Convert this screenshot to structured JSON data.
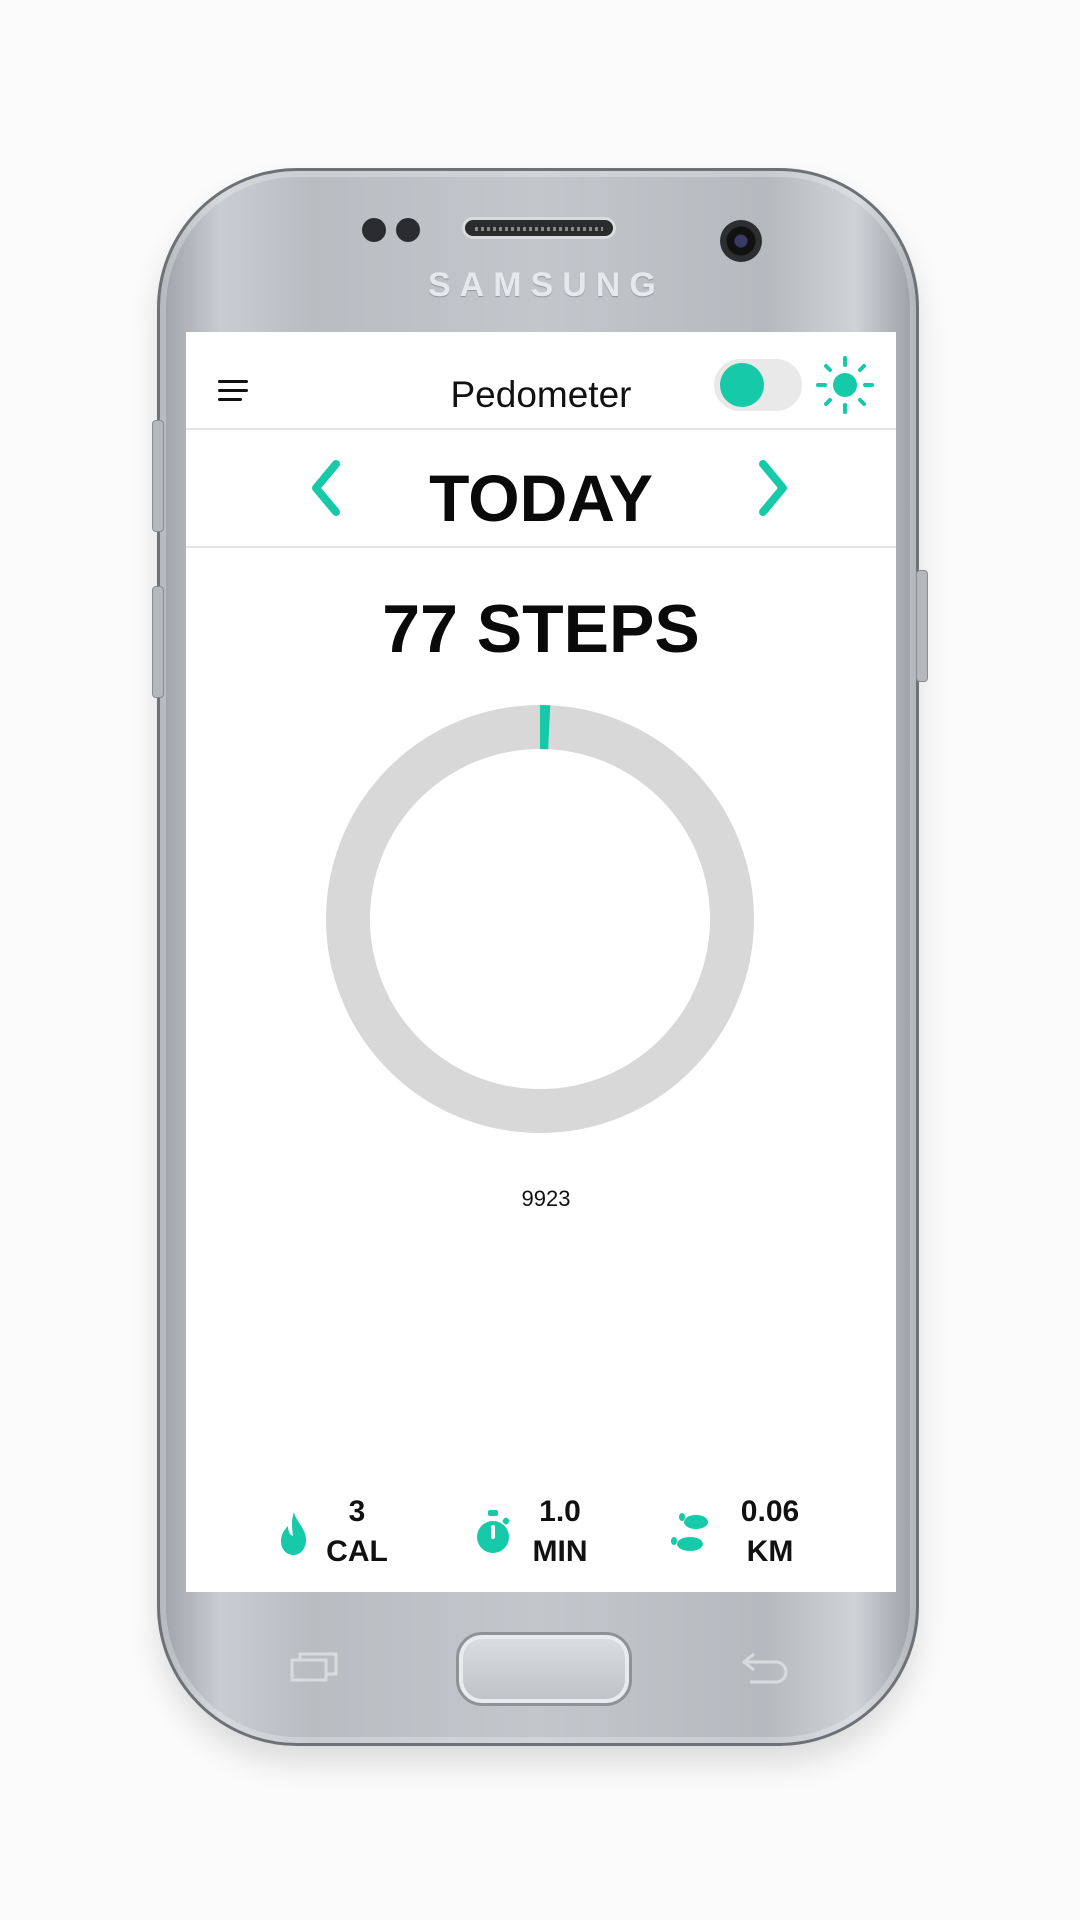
{
  "device": {
    "brand": "SAMSUNG"
  },
  "header": {
    "title": "Pedometer",
    "menu_icon": "hamburger-menu-icon",
    "theme_icon": "sun-icon",
    "toggle_on": true
  },
  "date_nav": {
    "label": "TODAY",
    "prev_icon": "chevron-left-icon",
    "next_icon": "chevron-right-icon"
  },
  "summary": {
    "steps_text": "77 STEPS"
  },
  "progress": {
    "current": 77,
    "current_label": "77",
    "remaining_label": "9923",
    "fraction": 0.0077
  },
  "stats": [
    {
      "icon": "flame-icon",
      "value": "3",
      "unit": "CAL"
    },
    {
      "icon": "stopwatch-icon",
      "value": "1.0",
      "unit": "MIN"
    },
    {
      "icon": "footprints-icon",
      "value": "0.06",
      "unit": "KM"
    }
  ],
  "colors": {
    "accent": "#16c9a8",
    "ring_track": "#d8d8d8",
    "text": "#111111"
  }
}
